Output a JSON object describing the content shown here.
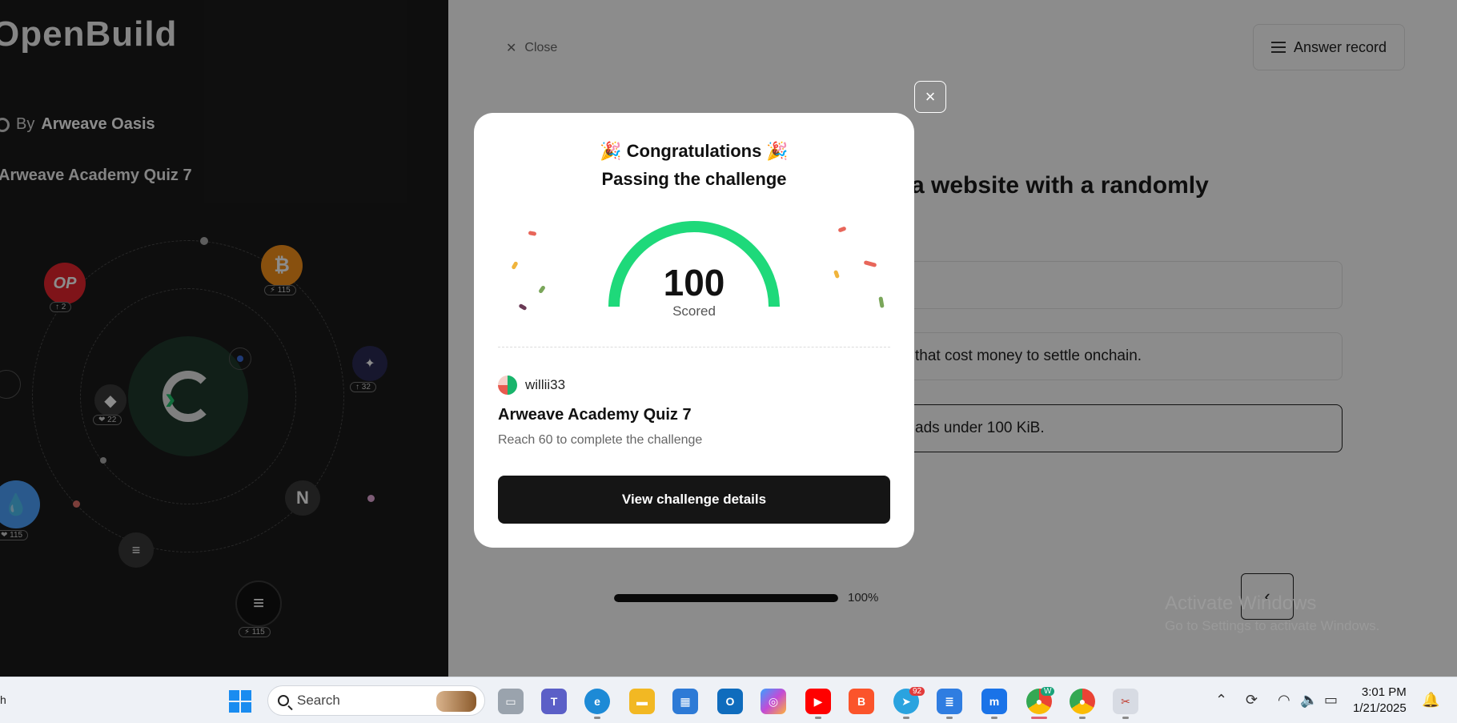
{
  "left_panel": {
    "brand": "OpenBuild",
    "by_label": "By",
    "by_org": "Arweave Oasis",
    "quiz_title": "Arweave Academy Quiz 7",
    "coins": [
      {
        "name": "OP",
        "badge": "↑ 2"
      },
      {
        "name": "Bitcoin",
        "badge": "⚡ 115"
      },
      {
        "name": "Ethereum",
        "badge": "❤ 22"
      },
      {
        "name": "Starknet",
        "badge": "↑ 32"
      },
      {
        "name": "Sui",
        "badge": "❤ 115"
      },
      {
        "name": "Near",
        "badge": ""
      },
      {
        "name": "Solana",
        "badge": ""
      },
      {
        "name": "Aptos",
        "badge": "⚡ 115"
      }
    ]
  },
  "quiz_page": {
    "close_label": "Close",
    "answer_record_label": "Answer record",
    "question_fragment": "a website with a randomly",
    "options": [
      {
        "text": "",
        "selected": false
      },
      {
        "text": "that cost money to settle onchain.",
        "selected": false
      },
      {
        "text": "ads under 100 KiB.",
        "selected": true
      }
    ],
    "progress": {
      "value": 1.0,
      "label": "100%"
    },
    "prev_icon": "‹"
  },
  "watermark": {
    "title": "Activate Windows",
    "subtitle": "Go to Settings to activate Windows."
  },
  "modal": {
    "close_icon": "×",
    "title_line1": "🎉 Congratulations 🎉",
    "title_line2": "Passing the challenge",
    "score": "100",
    "score_label": "Scored",
    "score_fraction": 1.0,
    "username": "willii33",
    "quiz_name": "Arweave Academy Quiz 7",
    "requirement": "Reach 60 to complete the challenge",
    "button_label": "View challenge details",
    "gauge_color": "#1ed97a"
  },
  "taskbar": {
    "left_text": "h",
    "search_placeholder": "Search",
    "telegram_badge": "92",
    "chrome_badge": "W",
    "time": "3:01 PM",
    "date": "1/21/2025"
  }
}
